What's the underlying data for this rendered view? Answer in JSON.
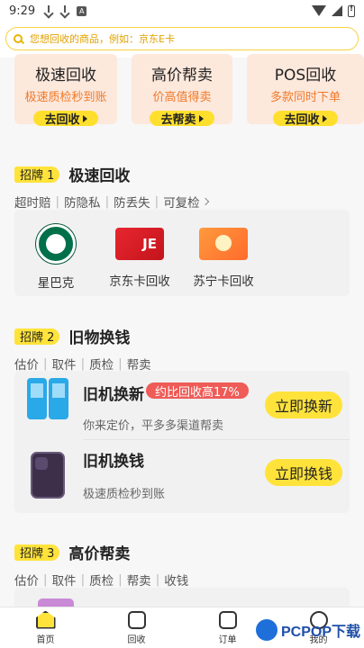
{
  "status": {
    "time": "9:29",
    "a_letter": "A"
  },
  "search": {
    "placeholder": "您想回收的商品，例如：京东E卡"
  },
  "top_cards": [
    {
      "title": "极速回收",
      "subtitle": "极速质检秒到账",
      "button": "去回收"
    },
    {
      "title": "高价帮卖",
      "subtitle": "价高值得卖",
      "button": "去帮卖"
    },
    {
      "title": "POS回收",
      "subtitle": "多款同时下单",
      "button": "去回收"
    }
  ],
  "section1": {
    "badge": "招牌 1",
    "title": "极速回收",
    "tags": [
      "超时赔",
      "防隐私",
      "防丢失",
      "可复检"
    ],
    "brands": [
      {
        "label": "星巴克",
        "icon": "starbucks-logo"
      },
      {
        "label": "京东卡回收",
        "icon": "jd-card-image",
        "card_text": "JE"
      },
      {
        "label": "苏宁卡回收",
        "icon": "suning-card-image"
      }
    ]
  },
  "section2": {
    "badge": "招牌 2",
    "title": "旧物换钱",
    "tags": [
      "估价",
      "取件",
      "质检",
      "帮卖"
    ],
    "items": [
      {
        "title": "旧机换新",
        "badge": "约比回收高17%",
        "subtitle": "你来定价，平多多渠道帮卖",
        "button": "立即换新"
      },
      {
        "title": "旧机换钱",
        "badge": "",
        "subtitle": "极速质检秒到账",
        "button": "立即换钱"
      }
    ]
  },
  "section3": {
    "badge": "招牌 3",
    "title": "高价帮卖",
    "tags": [
      "估价",
      "取件",
      "质检",
      "帮卖",
      "收钱"
    ]
  },
  "tabbar": [
    {
      "label": "首页",
      "icon": "home-icon"
    },
    {
      "label": "回收",
      "icon": "recycle-icon"
    },
    {
      "label": "订单",
      "icon": "order-icon"
    },
    {
      "label": "我的",
      "icon": "user-icon"
    }
  ],
  "watermark": {
    "text": "PCPOP下载"
  }
}
